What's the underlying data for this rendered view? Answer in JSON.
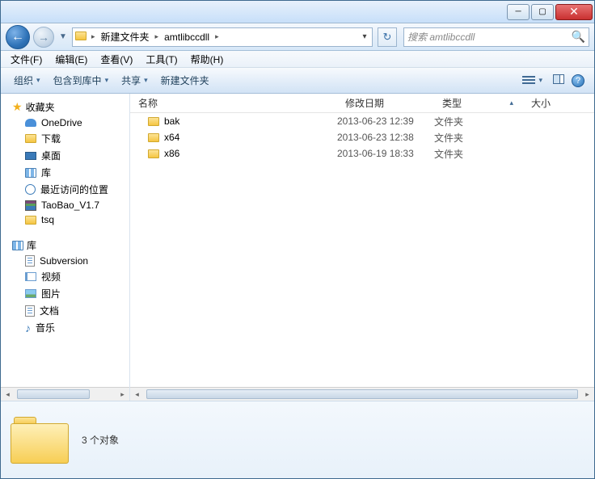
{
  "titlebar": {
    "min": "─",
    "max": "▢",
    "close": "✕"
  },
  "nav": {
    "back": "←",
    "fwd": "→",
    "dd": "▼",
    "addr_icon": "📁",
    "segs": [
      "新建文件夹",
      "amtlibccdll"
    ],
    "arrow": "▸",
    "dd2": "▾",
    "refresh": "↻"
  },
  "search": {
    "placeholder": "搜索 amtlibccdll",
    "icon": "🔍"
  },
  "menu": {
    "file": "文件(F)",
    "edit": "编辑(E)",
    "view": "查看(V)",
    "tools": "工具(T)",
    "help": "帮助(H)"
  },
  "toolbar": {
    "organize": "组织",
    "include": "包含到库中",
    "share": "共享",
    "newfolder": "新建文件夹",
    "dd": "▾",
    "help": "?"
  },
  "sidebar": {
    "fav_hdr": "收藏夹",
    "fav_items": [
      "OneDrive",
      "下载",
      "桌面",
      "库",
      "最近访问的位置",
      "TaoBao_V1.7",
      "tsq"
    ],
    "lib_hdr": "库",
    "lib_items": [
      "Subversion",
      "视频",
      "图片",
      "文档",
      "音乐"
    ]
  },
  "columns": {
    "name": "名称",
    "date": "修改日期",
    "type": "类型",
    "size": "大小",
    "sort": "▴"
  },
  "rows": [
    {
      "name": "bak",
      "date": "2013-06-23 12:39",
      "type": "文件夹"
    },
    {
      "name": "x64",
      "date": "2013-06-23 12:38",
      "type": "文件夹"
    },
    {
      "name": "x86",
      "date": "2013-06-19 18:33",
      "type": "文件夹"
    }
  ],
  "status": {
    "count": "3 个对象"
  }
}
